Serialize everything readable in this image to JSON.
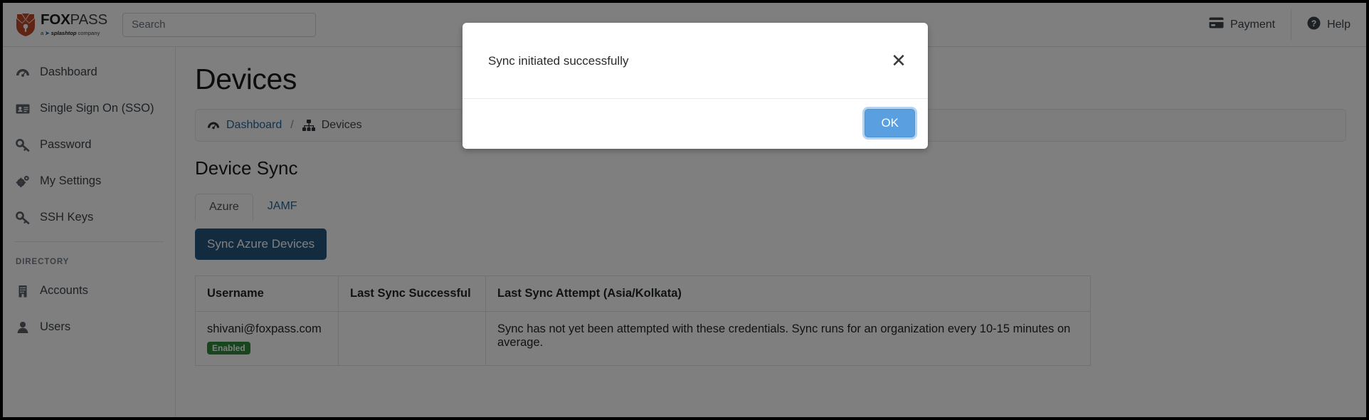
{
  "brand": {
    "name_bold": "FOX",
    "name_light": "PASS",
    "sub_prefix": "a",
    "sub_company": "splashtop",
    "sub_suffix": "company",
    "logo_icon": "fox-shield-logo"
  },
  "search": {
    "placeholder": "Search",
    "value": ""
  },
  "topbar": {
    "links": [
      {
        "label": "Payment",
        "icon": "credit-card-icon"
      },
      {
        "label": "Help",
        "icon": "question-circle-icon"
      }
    ]
  },
  "sidebar": {
    "items": [
      {
        "label": "Dashboard",
        "icon": "gauge-icon"
      },
      {
        "label": "Single Sign On (SSO)",
        "icon": "id-card-icon"
      },
      {
        "label": "Password",
        "icon": "key-icon"
      },
      {
        "label": "My Settings",
        "icon": "gears-icon"
      },
      {
        "label": "SSH Keys",
        "icon": "key-icon"
      }
    ],
    "section_label": "DIRECTORY",
    "directory_items": [
      {
        "label": "Accounts",
        "icon": "building-icon"
      },
      {
        "label": "Users",
        "icon": "user-icon"
      }
    ]
  },
  "main": {
    "page_title": "Devices",
    "breadcrumb": {
      "home_label": "Dashboard",
      "home_icon": "gauge-icon",
      "separator": "/",
      "current_label": "Devices",
      "current_icon": "sitemap-icon"
    },
    "section_title": "Device Sync",
    "tabs": [
      {
        "label": "Azure",
        "active": true
      },
      {
        "label": "JAMF",
        "active": false
      }
    ],
    "sync_button_label": "Sync Azure Devices",
    "table": {
      "columns": [
        "Username",
        "Last Sync Successful",
        "Last Sync Attempt (Asia/Kolkata)"
      ],
      "rows": [
        {
          "username": "shivani@foxpass.com",
          "status_badge": "Enabled",
          "last_sync_successful": "",
          "last_sync_attempt": "Sync has not yet been attempted with these credentials. Sync runs for an organization every 10-15 minutes on average."
        }
      ]
    }
  },
  "modal": {
    "message": "Sync initiated successfully",
    "close_icon": "close-icon",
    "ok_label": "OK"
  },
  "colors": {
    "accent_blue": "#26567f",
    "link_blue": "#20699c",
    "ok_blue": "#5a9fe0",
    "badge_green": "#2f8b3d",
    "brand_orange": "#c0482a"
  }
}
